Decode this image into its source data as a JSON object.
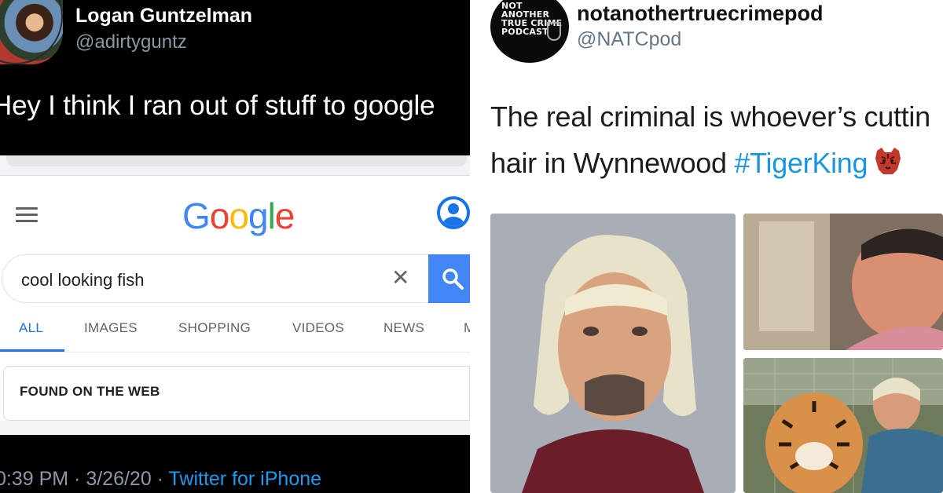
{
  "left_tweet": {
    "name": "Logan Guntzelman",
    "handle": "@adirtyguntz",
    "text": "Hey I think I ran out of stuff to google",
    "timestamp": "0:39 PM · 3/26/20 · ",
    "via": "Twitter for iPhone"
  },
  "google": {
    "logo_letters": [
      {
        "ch": "G",
        "color": "#4285F4"
      },
      {
        "ch": "o",
        "color": "#EA4335"
      },
      {
        "ch": "o",
        "color": "#FBBC05"
      },
      {
        "ch": "g",
        "color": "#4285F4"
      },
      {
        "ch": "l",
        "color": "#34A853"
      },
      {
        "ch": "e",
        "color": "#EA4335"
      }
    ],
    "search_query": "cool looking fish",
    "clear_glyph": "✕",
    "tabs": [
      "ALL",
      "IMAGES",
      "SHOPPING",
      "VIDEOS",
      "NEWS",
      "M"
    ],
    "active_tab": "ALL",
    "section_title": "FOUND ON THE WEB"
  },
  "right_tweet": {
    "avatar_lines": [
      "NOT",
      "ANOTHER",
      "TRUE CRIME",
      "PODCAST"
    ],
    "name": "notanothertruecrimepod",
    "handle": "@NATCpod",
    "text_line1": "The real criminal is whoever’s cuttin",
    "text_line2_prefix": "hair in Wynnewood ",
    "hashtag": "#TigerKing"
  },
  "colors": {
    "twitter_blue": "#1D9BF0",
    "google_blue": "#1A73E8",
    "search_button": "#4285F4"
  }
}
